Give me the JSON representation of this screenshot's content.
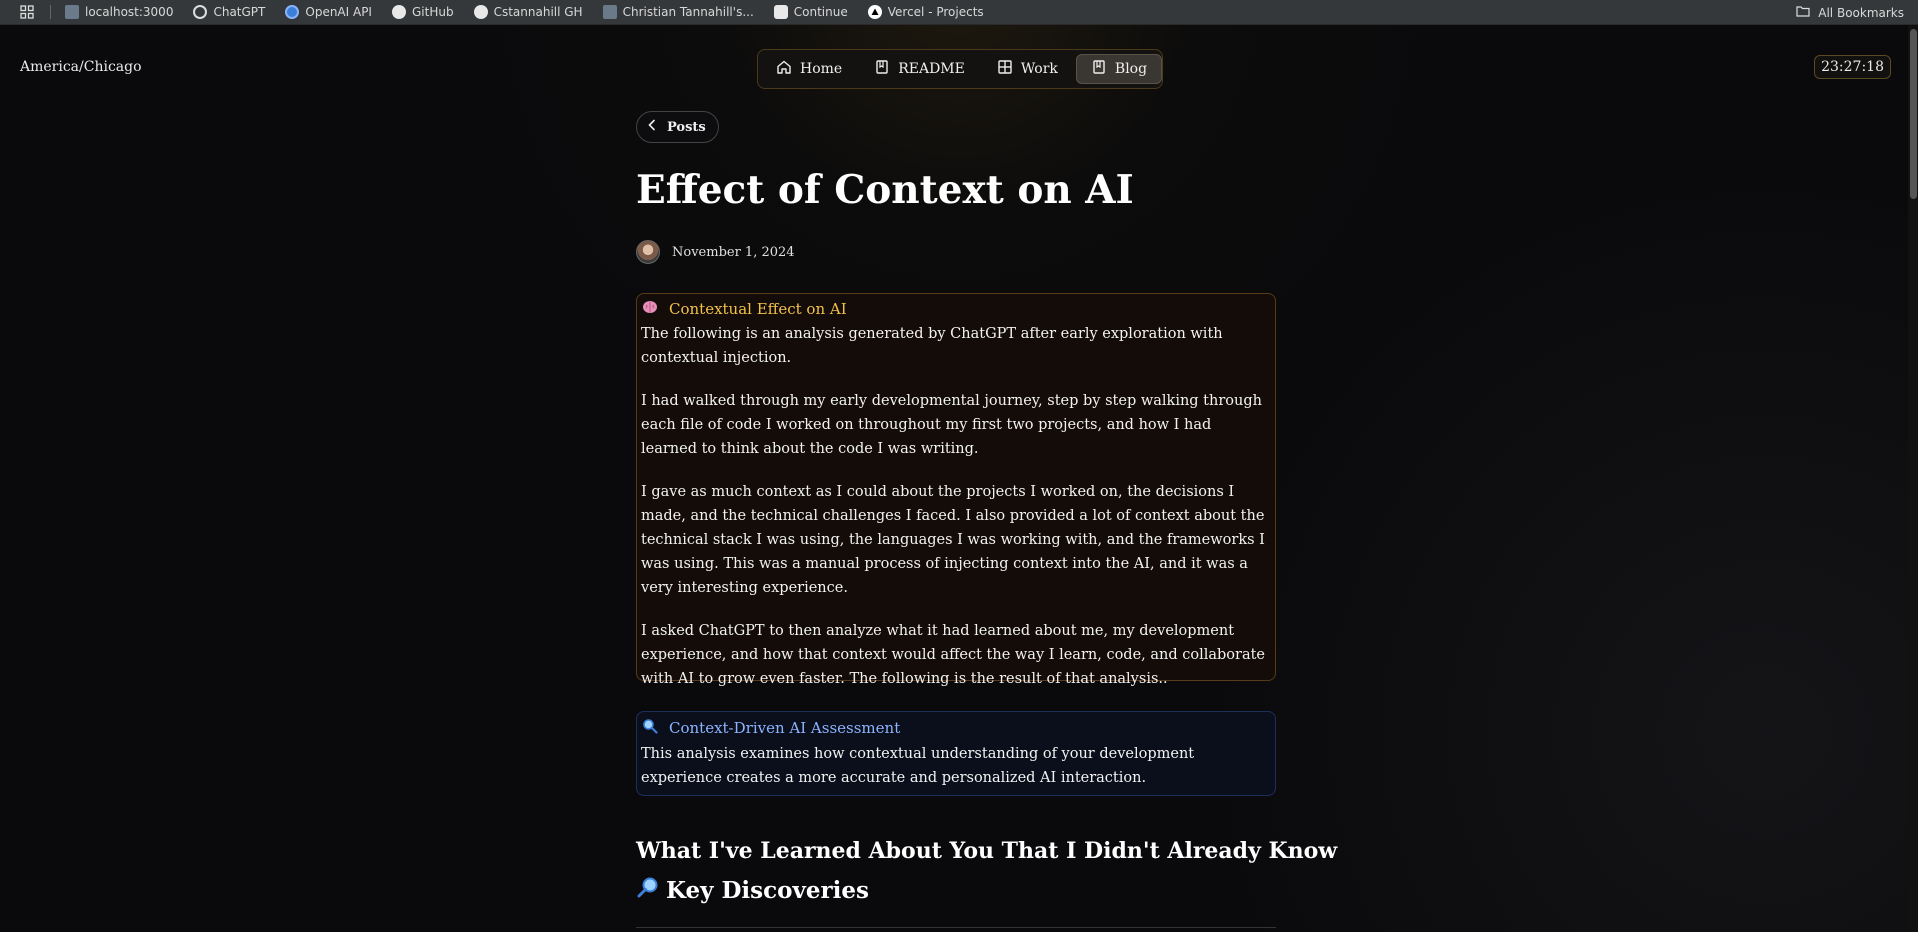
{
  "bookmarks": {
    "items": [
      {
        "label": "localhost:3000",
        "icon": "page-icon"
      },
      {
        "label": "ChatGPT",
        "icon": "chatgpt-icon"
      },
      {
        "label": "OpenAI API",
        "icon": "openai-icon"
      },
      {
        "label": "GitHub",
        "icon": "github-icon"
      },
      {
        "label": "Cstannahill GH",
        "icon": "github-icon"
      },
      {
        "label": "Christian Tannahill's...",
        "icon": "page-icon"
      },
      {
        "label": "Continue",
        "icon": "continue-icon"
      },
      {
        "label": "Vercel - Projects",
        "icon": "vercel-icon"
      }
    ],
    "all_label": "All Bookmarks"
  },
  "header": {
    "timezone": "America/Chicago",
    "clock": "23:27:18",
    "nav": [
      {
        "label": "Home",
        "icon": "home-icon",
        "active": false
      },
      {
        "label": "README",
        "icon": "book-icon",
        "active": false
      },
      {
        "label": "Work",
        "icon": "grid-icon",
        "active": false
      },
      {
        "label": "Blog",
        "icon": "book-icon",
        "active": true
      }
    ]
  },
  "post": {
    "back_label": "Posts",
    "title": "Effect of Context on AI",
    "date": "November 1, 2024",
    "callout1": {
      "icon": "brain-emoji",
      "title": "Contextual Effect on AI",
      "paragraphs": [
        "The following is an analysis generated by ChatGPT after early exploration with contextual injection.",
        "I had walked through my early developmental journey, step by step walking through each file of code I worked on throughout my first two projects, and how I had learned to think about the code I was writing.",
        "I gave as much context as I could about the projects I worked on, the decisions I made, and the technical challenges I faced. I also provided a lot of context about the technical stack I was using, the languages I was working with, and the frameworks I was using. This was a manual process of injecting context into the AI, and it was a very interesting experience.",
        "I asked ChatGPT to then analyze what it had learned about me, my development experience, and how that context would affect the way I learn, code, and collaborate with AI to grow even faster. The following is the result of that analysis.."
      ]
    },
    "callout2": {
      "icon": "magnifier-emoji",
      "title": "Context-Driven AI Assessment",
      "paragraphs": [
        "This analysis examines how contextual understanding of your development experience creates a more accurate and personalized AI interaction."
      ]
    },
    "heading2": "What I've Learned About You That I Didn't Already Know",
    "heading3": "Key Discoveries",
    "heading3_icon": "magnifier-emoji"
  }
}
